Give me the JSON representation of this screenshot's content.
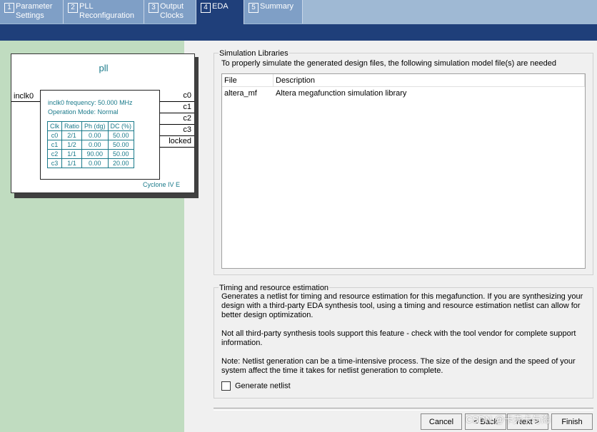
{
  "tabs": [
    {
      "num": "1",
      "label": "Parameter\nSettings"
    },
    {
      "num": "2",
      "label": "PLL\nReconfiguration"
    },
    {
      "num": "3",
      "label": "Output\nClocks"
    },
    {
      "num": "4",
      "label": "EDA"
    },
    {
      "num": "5",
      "label": "Summary"
    }
  ],
  "symbol": {
    "title": "pll",
    "input": "inclk0",
    "freq": "inclk0 frequency: 50.000 MHz",
    "mode": "Operation Mode: Normal",
    "outputs": [
      "c0",
      "c1",
      "c2",
      "c3",
      "locked"
    ],
    "device": "Cyclone IV E",
    "table": {
      "headers": [
        "Clk",
        "Ratio",
        "Ph (dg)",
        "DC (%)"
      ],
      "rows": [
        [
          "c0",
          "2/1",
          "0.00",
          "50.00"
        ],
        [
          "c1",
          "1/2",
          "0.00",
          "50.00"
        ],
        [
          "c2",
          "1/1",
          "90.00",
          "50.00"
        ],
        [
          "c3",
          "1/1",
          "0.00",
          "20.00"
        ]
      ]
    }
  },
  "sim": {
    "title": "Simulation Libraries",
    "desc": "To properly simulate the generated design files, the following simulation model file(s) are needed",
    "col_file": "File",
    "col_desc": "Description",
    "row_file": "altera_mf",
    "row_desc": "Altera megafunction simulation library"
  },
  "timing": {
    "title": "Timing and resource estimation",
    "p1": "Generates a netlist for timing and resource estimation for this megafunction. If you are synthesizing your design with a third-party EDA synthesis tool, using a timing and resource estimation netlist can allow for better design optimization.",
    "p2": "Not all third-party synthesis tools support this feature - check with the tool vendor for complete support information.",
    "p3": "Note: Netlist generation can be a time-intensive process. The size of the design and the speed of your system affect the time it takes for netlist generation to complete.",
    "checkbox": "Generate netlist",
    "checked": false
  },
  "buttons": {
    "cancel": "Cancel",
    "back": "< Back",
    "next": "Next >",
    "finish": "Finish"
  },
  "watermark": "CSDN @卡夫卡与海"
}
